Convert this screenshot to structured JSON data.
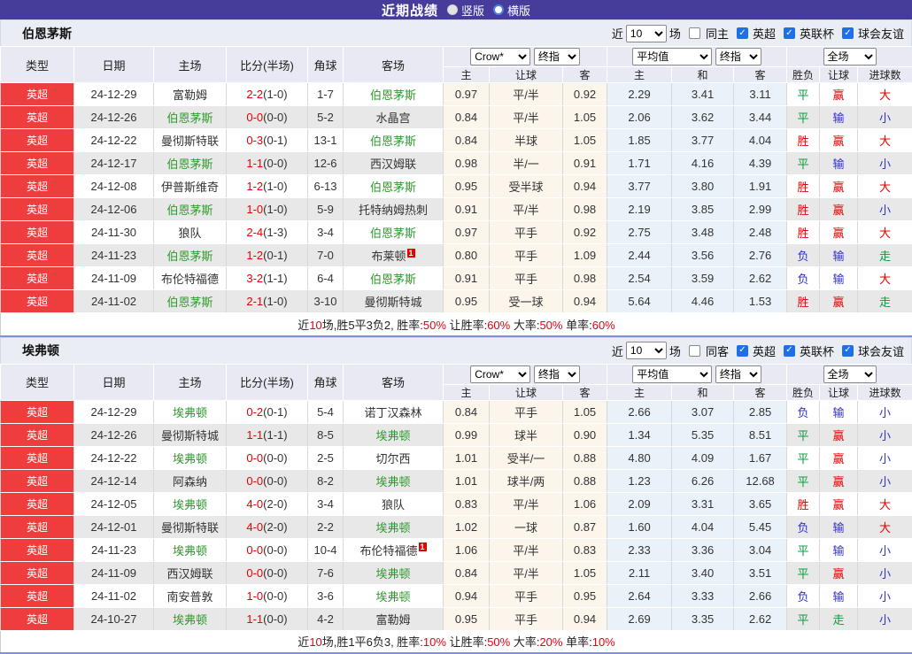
{
  "topbar": {
    "title": "近期战绩",
    "radios": [
      {
        "label": "竖版",
        "selected": true
      },
      {
        "label": "横版",
        "selected": false
      }
    ]
  },
  "palette": {
    "topbar_bg": "#453d99",
    "league_red": "#ef3c3c",
    "focus_green": "#2e9b2e",
    "result_red": "#e80000",
    "result_green": "#079b3c",
    "result_blue": "#3030cf",
    "asia_col_bg": "#fcf5ec",
    "euro_col_bg": "#eaf2f9",
    "divider_blue": "#7f90d9"
  },
  "filters": {
    "near_label": "近",
    "count": "10",
    "field_label": "场",
    "league_options": [
      "英超",
      "英联杯",
      "球会友谊"
    ]
  },
  "columns": {
    "type": "类型",
    "date": "日期",
    "home": "主场",
    "score": "比分(半场)",
    "corner": "角球",
    "away": "客场",
    "asia_cols": [
      "主",
      "让球",
      "客"
    ],
    "euro_cols": [
      "主",
      "和",
      "客"
    ],
    "result_cols": [
      "胜负",
      "让球",
      "进球数"
    ]
  },
  "header_selects": {
    "crow": "Crow*",
    "final1": "终指",
    "avg": "平均值",
    "final2": "终指",
    "full": "全场"
  },
  "sections": [
    {
      "team": "伯恩茅斯",
      "same_label": "同主",
      "rows": [
        {
          "league": "英超",
          "date": "24-12-29",
          "home": "富勒姆",
          "home_focus": false,
          "home_card": "",
          "score": "2-2",
          "half": "(1-0)",
          "corner": "1-7",
          "away": "伯恩茅斯",
          "away_focus": true,
          "away_card": "",
          "asia": [
            "0.97",
            "平/半",
            "0.92"
          ],
          "avg": [
            "2.29",
            "3.41",
            "3.11"
          ],
          "results": [
            "平",
            "赢",
            "大"
          ]
        },
        {
          "league": "英超",
          "date": "24-12-26",
          "home": "伯恩茅斯",
          "home_focus": true,
          "home_card": "",
          "score": "0-0",
          "half": "(0-0)",
          "corner": "5-2",
          "away": "水晶宫",
          "away_focus": false,
          "away_card": "",
          "asia": [
            "0.84",
            "平/半",
            "1.05"
          ],
          "avg": [
            "2.06",
            "3.62",
            "3.44"
          ],
          "results": [
            "平",
            "输",
            "小"
          ]
        },
        {
          "league": "英超",
          "date": "24-12-22",
          "home": "曼彻斯特联",
          "home_focus": false,
          "home_card": "",
          "score": "0-3",
          "half": "(0-1)",
          "corner": "13-1",
          "away": "伯恩茅斯",
          "away_focus": true,
          "away_card": "",
          "asia": [
            "0.84",
            "半球",
            "1.05"
          ],
          "avg": [
            "1.85",
            "3.77",
            "4.04"
          ],
          "results": [
            "胜",
            "赢",
            "大"
          ]
        },
        {
          "league": "英超",
          "date": "24-12-17",
          "home": "伯恩茅斯",
          "home_focus": true,
          "home_card": "",
          "score": "1-1",
          "half": "(0-0)",
          "corner": "12-6",
          "away": "西汉姆联",
          "away_focus": false,
          "away_card": "",
          "asia": [
            "0.98",
            "半/一",
            "0.91"
          ],
          "avg": [
            "1.71",
            "4.16",
            "4.39"
          ],
          "results": [
            "平",
            "输",
            "小"
          ]
        },
        {
          "league": "英超",
          "date": "24-12-08",
          "home": "伊普斯维奇",
          "home_focus": false,
          "home_card": "",
          "score": "1-2",
          "half": "(1-0)",
          "corner": "6-13",
          "away": "伯恩茅斯",
          "away_focus": true,
          "away_card": "",
          "asia": [
            "0.95",
            "受半球",
            "0.94"
          ],
          "avg": [
            "3.77",
            "3.80",
            "1.91"
          ],
          "results": [
            "胜",
            "赢",
            "大"
          ]
        },
        {
          "league": "英超",
          "date": "24-12-06",
          "home": "伯恩茅斯",
          "home_focus": true,
          "home_card": "",
          "score": "1-0",
          "half": "(1-0)",
          "corner": "5-9",
          "away": "托特纳姆热刺",
          "away_focus": false,
          "away_card": "",
          "asia": [
            "0.91",
            "平/半",
            "0.98"
          ],
          "avg": [
            "2.19",
            "3.85",
            "2.99"
          ],
          "results": [
            "胜",
            "赢",
            "小"
          ]
        },
        {
          "league": "英超",
          "date": "24-11-30",
          "home": "狼队",
          "home_focus": false,
          "home_card": "",
          "score": "2-4",
          "half": "(1-3)",
          "corner": "3-4",
          "away": "伯恩茅斯",
          "away_focus": true,
          "away_card": "",
          "asia": [
            "0.97",
            "平手",
            "0.92"
          ],
          "avg": [
            "2.75",
            "3.48",
            "2.48"
          ],
          "results": [
            "胜",
            "赢",
            "大"
          ]
        },
        {
          "league": "英超",
          "date": "24-11-23",
          "home": "伯恩茅斯",
          "home_focus": true,
          "home_card": "",
          "score": "1-2",
          "half": "(0-1)",
          "corner": "7-0",
          "away": "布莱顿",
          "away_focus": false,
          "away_card": "1",
          "asia": [
            "0.80",
            "平手",
            "1.09"
          ],
          "avg": [
            "2.44",
            "3.56",
            "2.76"
          ],
          "results": [
            "负",
            "输",
            "走"
          ]
        },
        {
          "league": "英超",
          "date": "24-11-09",
          "home": "布伦特福德",
          "home_focus": false,
          "home_card": "",
          "score": "3-2",
          "half": "(1-1)",
          "corner": "6-4",
          "away": "伯恩茅斯",
          "away_focus": true,
          "away_card": "",
          "asia": [
            "0.91",
            "平手",
            "0.98"
          ],
          "avg": [
            "2.54",
            "3.59",
            "2.62"
          ],
          "results": [
            "负",
            "输",
            "大"
          ]
        },
        {
          "league": "英超",
          "date": "24-11-02",
          "home": "伯恩茅斯",
          "home_focus": true,
          "home_card": "",
          "score": "2-1",
          "half": "(1-0)",
          "corner": "3-10",
          "away": "曼彻斯特城",
          "away_focus": false,
          "away_card": "",
          "asia": [
            "0.95",
            "受一球",
            "0.94"
          ],
          "avg": [
            "5.64",
            "4.46",
            "1.53"
          ],
          "results": [
            "胜",
            "赢",
            "走"
          ]
        }
      ],
      "summary": [
        {
          "t": "近",
          "red": false
        },
        {
          "t": "10",
          "red": true
        },
        {
          "t": "场,胜5平3负2, 胜率:",
          "red": false
        },
        {
          "t": "50%",
          "red": true
        },
        {
          "t": " 让胜率:",
          "red": false
        },
        {
          "t": "60%",
          "red": true
        },
        {
          "t": " 大率:",
          "red": false
        },
        {
          "t": "50%",
          "red": true
        },
        {
          "t": " 单率:",
          "red": false
        },
        {
          "t": "60%",
          "red": true
        }
      ]
    },
    {
      "team": "埃弗顿",
      "same_label": "同客",
      "rows": [
        {
          "league": "英超",
          "date": "24-12-29",
          "home": "埃弗顿",
          "home_focus": true,
          "home_card": "",
          "score": "0-2",
          "half": "(0-1)",
          "corner": "5-4",
          "away": "诺丁汉森林",
          "away_focus": false,
          "away_card": "",
          "asia": [
            "0.84",
            "平手",
            "1.05"
          ],
          "avg": [
            "2.66",
            "3.07",
            "2.85"
          ],
          "results": [
            "负",
            "输",
            "小"
          ]
        },
        {
          "league": "英超",
          "date": "24-12-26",
          "home": "曼彻斯特城",
          "home_focus": false,
          "home_card": "",
          "score": "1-1",
          "half": "(1-1)",
          "corner": "8-5",
          "away": "埃弗顿",
          "away_focus": true,
          "away_card": "",
          "asia": [
            "0.99",
            "球半",
            "0.90"
          ],
          "avg": [
            "1.34",
            "5.35",
            "8.51"
          ],
          "results": [
            "平",
            "赢",
            "小"
          ]
        },
        {
          "league": "英超",
          "date": "24-12-22",
          "home": "埃弗顿",
          "home_focus": true,
          "home_card": "",
          "score": "0-0",
          "half": "(0-0)",
          "corner": "2-5",
          "away": "切尔西",
          "away_focus": false,
          "away_card": "",
          "asia": [
            "1.01",
            "受半/一",
            "0.88"
          ],
          "avg": [
            "4.80",
            "4.09",
            "1.67"
          ],
          "results": [
            "平",
            "赢",
            "小"
          ]
        },
        {
          "league": "英超",
          "date": "24-12-14",
          "home": "阿森纳",
          "home_focus": false,
          "home_card": "",
          "score": "0-0",
          "half": "(0-0)",
          "corner": "8-2",
          "away": "埃弗顿",
          "away_focus": true,
          "away_card": "",
          "asia": [
            "1.01",
            "球半/两",
            "0.88"
          ],
          "avg": [
            "1.23",
            "6.26",
            "12.68"
          ],
          "results": [
            "平",
            "赢",
            "小"
          ]
        },
        {
          "league": "英超",
          "date": "24-12-05",
          "home": "埃弗顿",
          "home_focus": true,
          "home_card": "",
          "score": "4-0",
          "half": "(2-0)",
          "corner": "3-4",
          "away": "狼队",
          "away_focus": false,
          "away_card": "",
          "asia": [
            "0.83",
            "平/半",
            "1.06"
          ],
          "avg": [
            "2.09",
            "3.31",
            "3.65"
          ],
          "results": [
            "胜",
            "赢",
            "大"
          ]
        },
        {
          "league": "英超",
          "date": "24-12-01",
          "home": "曼彻斯特联",
          "home_focus": false,
          "home_card": "",
          "score": "4-0",
          "half": "(2-0)",
          "corner": "2-2",
          "away": "埃弗顿",
          "away_focus": true,
          "away_card": "",
          "asia": [
            "1.02",
            "一球",
            "0.87"
          ],
          "avg": [
            "1.60",
            "4.04",
            "5.45"
          ],
          "results": [
            "负",
            "输",
            "大"
          ]
        },
        {
          "league": "英超",
          "date": "24-11-23",
          "home": "埃弗顿",
          "home_focus": true,
          "home_card": "",
          "score": "0-0",
          "half": "(0-0)",
          "corner": "10-4",
          "away": "布伦特福德",
          "away_focus": false,
          "away_card": "1",
          "asia": [
            "1.06",
            "平/半",
            "0.83"
          ],
          "avg": [
            "2.33",
            "3.36",
            "3.04"
          ],
          "results": [
            "平",
            "输",
            "小"
          ]
        },
        {
          "league": "英超",
          "date": "24-11-09",
          "home": "西汉姆联",
          "home_focus": false,
          "home_card": "",
          "score": "0-0",
          "half": "(0-0)",
          "corner": "7-6",
          "away": "埃弗顿",
          "away_focus": true,
          "away_card": "",
          "asia": [
            "0.84",
            "平/半",
            "1.05"
          ],
          "avg": [
            "2.11",
            "3.40",
            "3.51"
          ],
          "results": [
            "平",
            "赢",
            "小"
          ]
        },
        {
          "league": "英超",
          "date": "24-11-02",
          "home": "南安普敦",
          "home_focus": false,
          "home_card": "",
          "score": "1-0",
          "half": "(0-0)",
          "corner": "3-6",
          "away": "埃弗顿",
          "away_focus": true,
          "away_card": "",
          "asia": [
            "0.94",
            "平手",
            "0.95"
          ],
          "avg": [
            "2.64",
            "3.33",
            "2.66"
          ],
          "results": [
            "负",
            "输",
            "小"
          ]
        },
        {
          "league": "英超",
          "date": "24-10-27",
          "home": "埃弗顿",
          "home_focus": true,
          "home_card": "",
          "score": "1-1",
          "half": "(0-0)",
          "corner": "4-2",
          "away": "富勒姆",
          "away_focus": false,
          "away_card": "",
          "asia": [
            "0.95",
            "平手",
            "0.94"
          ],
          "avg": [
            "2.69",
            "3.35",
            "2.62"
          ],
          "results": [
            "平",
            "走",
            "小"
          ]
        }
      ],
      "summary": [
        {
          "t": "近",
          "red": false
        },
        {
          "t": "10",
          "red": true
        },
        {
          "t": "场,胜1平6负3, 胜率:",
          "red": false
        },
        {
          "t": "10%",
          "red": true
        },
        {
          "t": " 让胜率:",
          "red": false
        },
        {
          "t": "50%",
          "red": true
        },
        {
          "t": " 大率:",
          "red": false
        },
        {
          "t": "20%",
          "red": true
        },
        {
          "t": " 单率:",
          "red": false
        },
        {
          "t": "10%",
          "red": true
        }
      ]
    }
  ]
}
